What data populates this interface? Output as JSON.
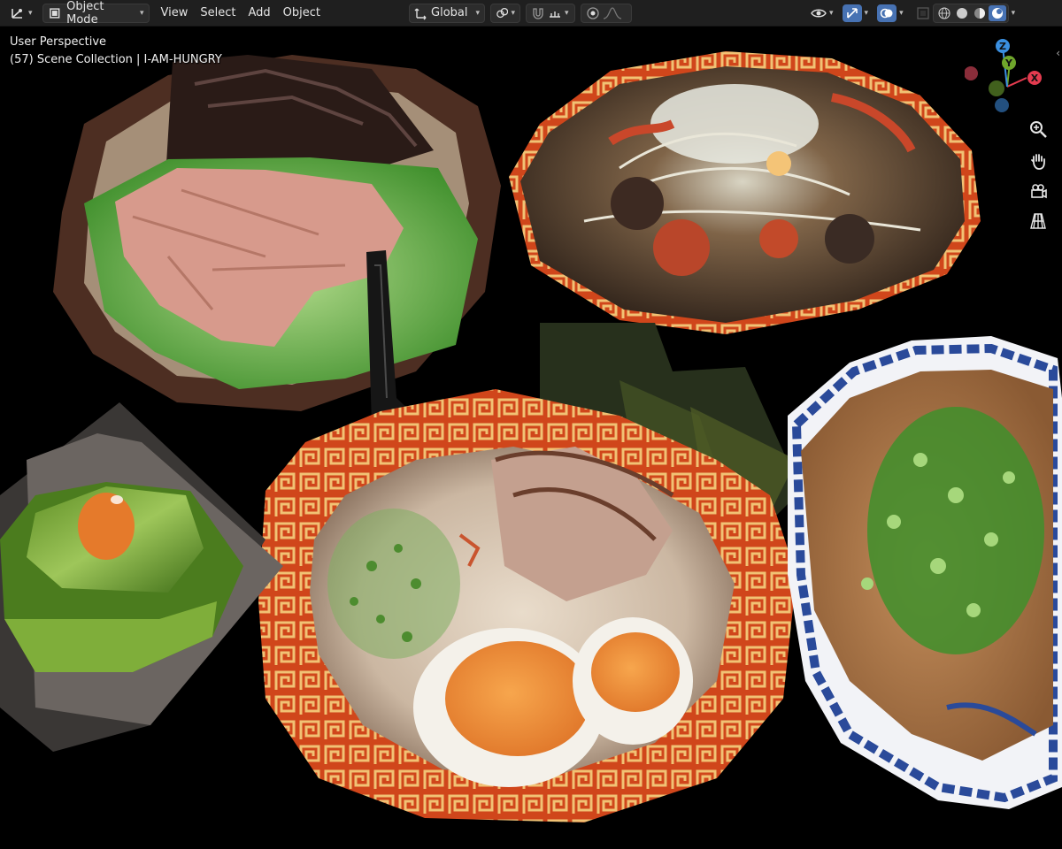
{
  "header": {
    "editor_type_icon": "axis-editor-icon",
    "mode_label": "Object Mode",
    "menus": [
      "View",
      "Select",
      "Add",
      "Object"
    ],
    "transform_orientation": "Global"
  },
  "viewport": {
    "view_name": "User Perspective",
    "collection_info": "(57) Scene Collection | I-AM-HUNGRY"
  },
  "gizmo": {
    "axes": {
      "x": "X",
      "y": "Y",
      "z": "Z"
    },
    "colors": {
      "x": "#e43b4f",
      "y": "#6fa62b",
      "z": "#3a8fe0"
    }
  },
  "nav_buttons": [
    "zoom-icon",
    "hand-pan-icon",
    "camera-icon",
    "grid-perspective-icon"
  ],
  "scene_objects": [
    "plate-chashu-greens",
    "bowl-stirfry-sprouts",
    "spoon-black",
    "bowl-tonkotsu-ramen",
    "plate-green-onion-pork",
    "hexagon-green-dish",
    "nori-sheets"
  ]
}
